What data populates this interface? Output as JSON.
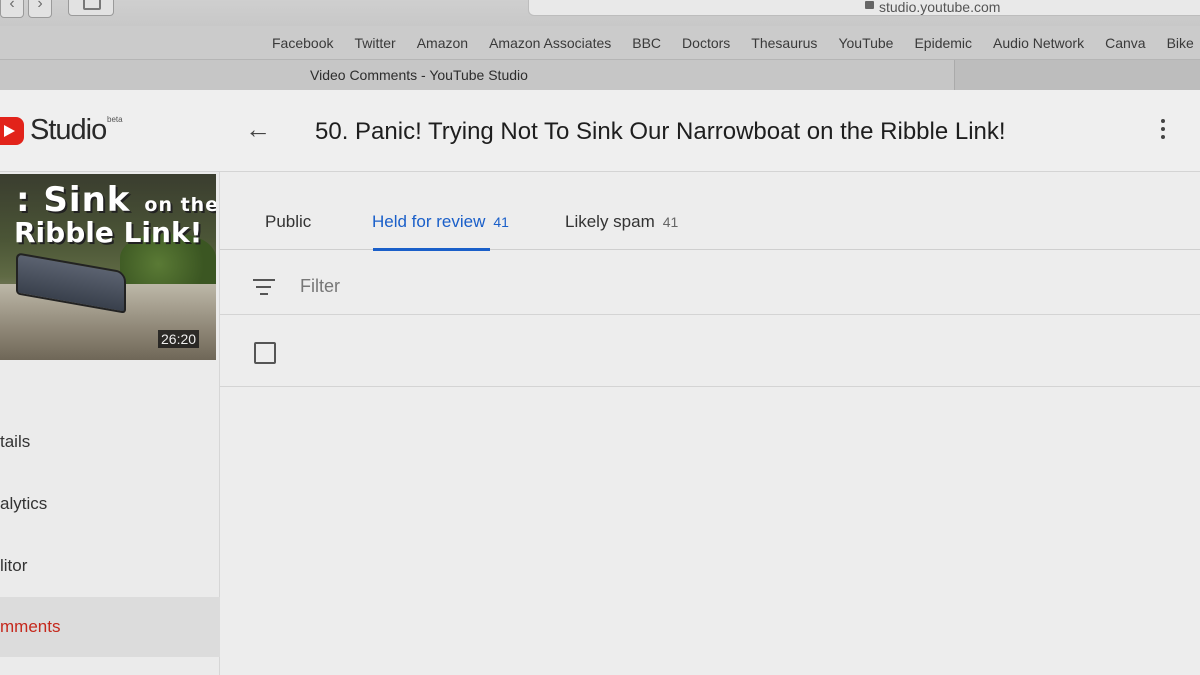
{
  "browser": {
    "url": "studio.youtube.com",
    "tab_title": "Video Comments - YouTube Studio",
    "bookmarks": [
      "Facebook",
      "Twitter",
      "Amazon",
      "Amazon Associates",
      "BBC",
      "Doctors",
      "Thesaurus",
      "YouTube",
      "Epidemic",
      "Audio Network",
      "Canva",
      "Bike"
    ]
  },
  "header": {
    "logo_text": "Studio",
    "logo_badge": "beta",
    "back_icon": "back-arrow-icon",
    "video_title": "50. Panic! Trying Not To Sink Our Narrowboat on the Ribble Link!",
    "more_icon": "more-vert-icon"
  },
  "sidebar": {
    "thumbnail": {
      "text_line1": ": Sink",
      "text_line1_small": "on the",
      "text_line2": "Ribble Link!",
      "duration": "26:20"
    },
    "items": [
      {
        "label": "tails",
        "active": false
      },
      {
        "label": "alytics",
        "active": false
      },
      {
        "label": "litor",
        "active": false
      },
      {
        "label": "mments",
        "active": true
      }
    ]
  },
  "main": {
    "tabs": [
      {
        "label": "Public",
        "count": ""
      },
      {
        "label": "Held for review",
        "count": "41"
      },
      {
        "label": "Likely spam",
        "count": "41"
      }
    ],
    "active_tab": 1,
    "filter_placeholder": "Filter"
  },
  "colors": {
    "accent_blue": "#1a5fc9",
    "youtube_red": "#e2231a",
    "active_nav_red": "#c5281c"
  }
}
